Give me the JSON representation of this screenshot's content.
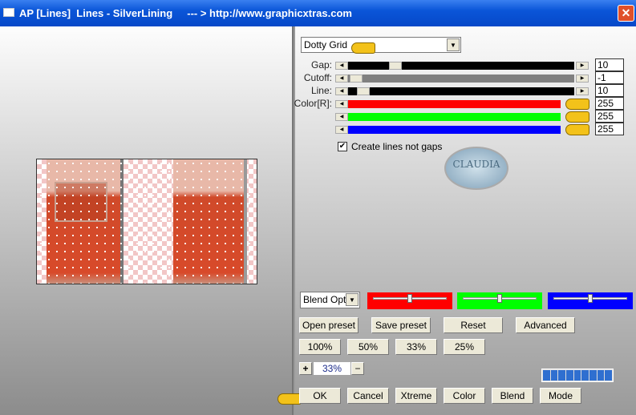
{
  "window": {
    "title": "AP [Lines]  Lines - SilverLining     --- > http://www.graphicxtras.com",
    "close": "✕"
  },
  "controls": {
    "effect_dropdown": "Dotty Grid",
    "sliders": [
      {
        "label": "Gap:",
        "value": "10",
        "position": 0.19,
        "color": "#000000"
      },
      {
        "label": "Cutoff:",
        "value": "-1",
        "position": 0.0,
        "color": "#808080"
      },
      {
        "label": "Line:",
        "value": "10",
        "position": 0.04,
        "color": "#000000"
      },
      {
        "label": "Color[R]:",
        "value": "255",
        "position": 1.0,
        "color": "#ff0000"
      },
      {
        "label": "",
        "value": "255",
        "position": 1.0,
        "color": "#00ff00"
      },
      {
        "label": "",
        "value": "255",
        "position": 1.0,
        "color": "#0000ff"
      }
    ],
    "checkbox": {
      "label": "Create lines not gaps",
      "checked": true
    },
    "logo_text": "CLAUDIA",
    "blend_dropdown": "Blend Opti",
    "blend_sliders": [
      {
        "color": "#ff0000",
        "position": 0.5
      },
      {
        "color": "#00ff00",
        "position": 0.5
      },
      {
        "color": "#0000ff",
        "position": 0.5
      }
    ],
    "preset_buttons": [
      "Open preset",
      "Save preset",
      "Reset",
      "Advanced"
    ],
    "zoom_buttons": [
      "100%",
      "50%",
      "33%",
      "25%"
    ],
    "zoom": {
      "plus": "+",
      "value": "33%",
      "minus": "−"
    },
    "bottom_buttons": [
      "OK",
      "Cancel",
      "Xtreme",
      "Color",
      "Blend",
      "Mode"
    ],
    "progress_segments": 9
  }
}
